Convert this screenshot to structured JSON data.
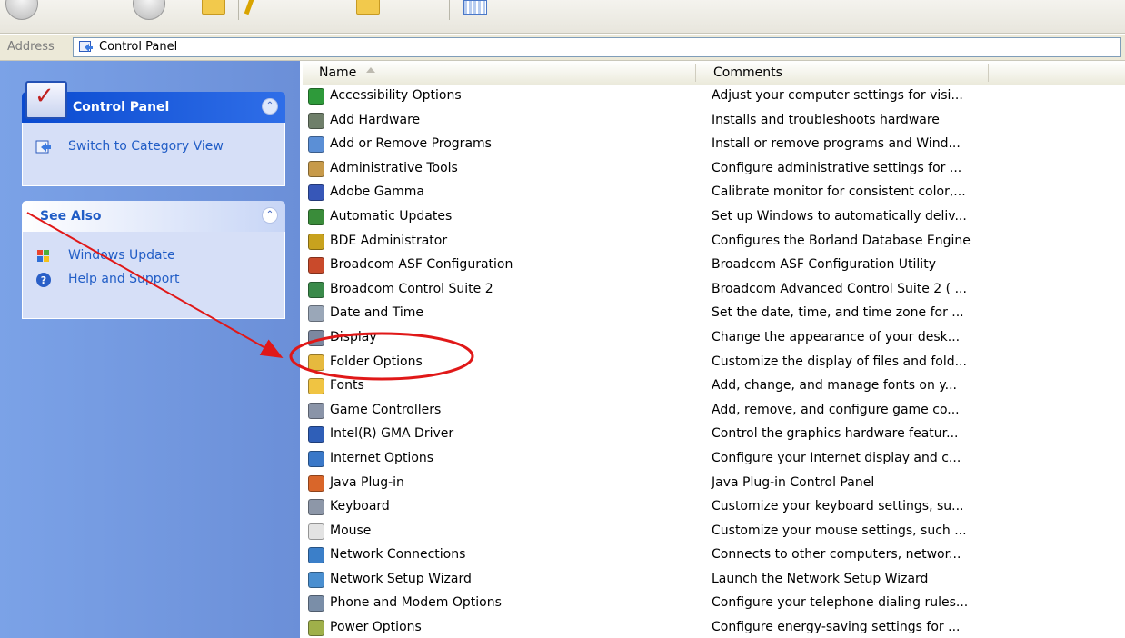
{
  "address": {
    "label": "Address",
    "value": "Control Panel"
  },
  "taskpane": {
    "control_panel": {
      "title": "Control Panel",
      "tasks": [
        {
          "label": "Switch to Category View",
          "icon": "switch-view-icon"
        }
      ]
    },
    "see_also": {
      "title": "See Also",
      "tasks": [
        {
          "label": "Windows Update",
          "icon": "windows-update-icon"
        },
        {
          "label": "Help and Support",
          "icon": "help-icon"
        }
      ]
    }
  },
  "list": {
    "columns": {
      "name": "Name",
      "comments": "Comments"
    },
    "items": [
      {
        "name": "Accessibility Options",
        "comment": "Adjust your computer settings for visi...",
        "icon": "accessibility-icon",
        "color": "#2e9a3a"
      },
      {
        "name": "Add Hardware",
        "comment": "Installs and troubleshoots hardware",
        "icon": "add-hardware-icon",
        "color": "#6f7f6a"
      },
      {
        "name": "Add or Remove Programs",
        "comment": "Install or remove programs and Wind...",
        "icon": "add-remove-programs-icon",
        "color": "#5b8fd6"
      },
      {
        "name": "Administrative Tools",
        "comment": "Configure administrative settings for ...",
        "icon": "administrative-tools-icon",
        "color": "#c79a4a"
      },
      {
        "name": "Adobe Gamma",
        "comment": "Calibrate monitor for consistent color,...",
        "icon": "adobe-gamma-icon",
        "color": "#3757b8"
      },
      {
        "name": "Automatic Updates",
        "comment": "Set up Windows to automatically deliv...",
        "icon": "automatic-updates-icon",
        "color": "#3a8c3a"
      },
      {
        "name": "BDE Administrator",
        "comment": "Configures the Borland Database Engine",
        "icon": "bde-administrator-icon",
        "color": "#c8a21e"
      },
      {
        "name": "Broadcom ASF Configuration",
        "comment": "Broadcom ASF Configuration Utility",
        "icon": "broadcom-asf-icon",
        "color": "#c94a2b"
      },
      {
        "name": "Broadcom Control Suite 2",
        "comment": "Broadcom Advanced Control Suite 2 ( ...",
        "icon": "broadcom-control-suite-icon",
        "color": "#3a8a4a"
      },
      {
        "name": "Date and Time",
        "comment": "Set the date, time, and time zone for ...",
        "icon": "date-time-icon",
        "color": "#9aa7b8"
      },
      {
        "name": "Display",
        "comment": "Change the appearance of your desk...",
        "icon": "display-icon",
        "color": "#7c88a0"
      },
      {
        "name": "Folder Options",
        "comment": "Customize the display of files and fold...",
        "icon": "folder-options-icon",
        "color": "#e6b93e"
      },
      {
        "name": "Fonts",
        "comment": "Add, change, and manage fonts on y...",
        "icon": "fonts-icon",
        "color": "#f0c442"
      },
      {
        "name": "Game Controllers",
        "comment": "Add, remove, and configure game co...",
        "icon": "game-controllers-icon",
        "color": "#8a94a8"
      },
      {
        "name": "Intel(R) GMA Driver",
        "comment": "Control the graphics hardware featur...",
        "icon": "intel-gma-icon",
        "color": "#2f5fb8"
      },
      {
        "name": "Internet Options",
        "comment": "Configure your Internet display and c...",
        "icon": "internet-options-icon",
        "color": "#3a78c8"
      },
      {
        "name": "Java Plug-in",
        "comment": "Java Plug-in Control Panel",
        "icon": "java-icon",
        "color": "#d9662a"
      },
      {
        "name": "Keyboard",
        "comment": "Customize your keyboard settings, su...",
        "icon": "keyboard-icon",
        "color": "#8d97a8"
      },
      {
        "name": "Mouse",
        "comment": "Customize your mouse settings, such ...",
        "icon": "mouse-icon",
        "color": "#e3e3e3"
      },
      {
        "name": "Network Connections",
        "comment": "Connects to other computers, networ...",
        "icon": "network-connections-icon",
        "color": "#3b7fc9"
      },
      {
        "name": "Network Setup Wizard",
        "comment": "Launch the Network Setup Wizard",
        "icon": "network-setup-wizard-icon",
        "color": "#4a8fd0"
      },
      {
        "name": "Phone and Modem Options",
        "comment": "Configure your telephone dialing rules...",
        "icon": "phone-modem-icon",
        "color": "#7a8ea8"
      },
      {
        "name": "Power Options",
        "comment": "Configure energy-saving settings for ...",
        "icon": "power-options-icon",
        "color": "#9fb04a"
      }
    ]
  },
  "colors": {
    "taskpane_bg": "#7ba2e7",
    "task_link": "#215dc6",
    "annotation_red": "#e01818"
  }
}
